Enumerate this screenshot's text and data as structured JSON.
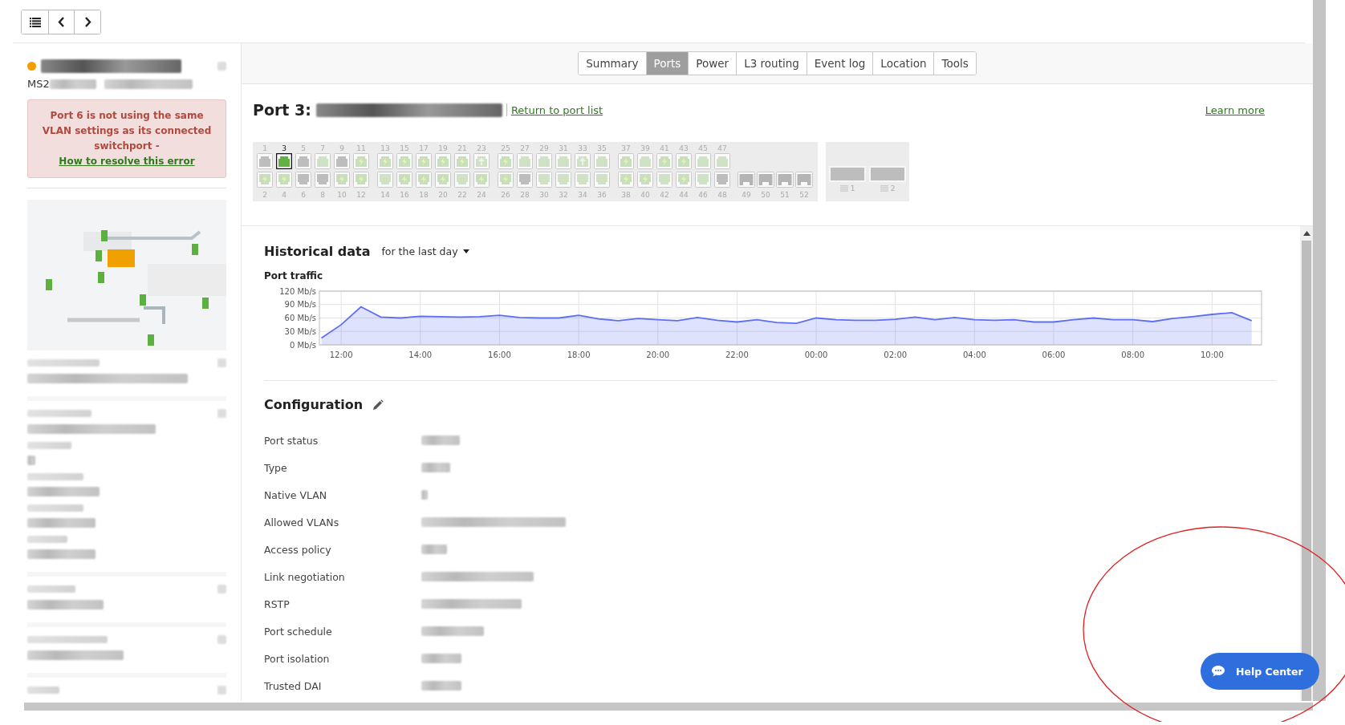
{
  "toolbar": {
    "buttons": [
      {
        "kind": "list"
      },
      {
        "kind": "prev"
      },
      {
        "kind": "next"
      }
    ]
  },
  "sidebar": {
    "model_prefix": "MS2",
    "alert": {
      "text": "Port 6 is not using the same VLAN settings as its connected switchport - ",
      "link": "How to resolve this error"
    }
  },
  "tabs": [
    {
      "label": "Summary",
      "selected": false
    },
    {
      "label": "Ports",
      "selected": true
    },
    {
      "label": "Power",
      "selected": false
    },
    {
      "label": "L3 routing",
      "selected": false
    },
    {
      "label": "Event log",
      "selected": false
    },
    {
      "label": "Location",
      "selected": false
    },
    {
      "label": "Tools",
      "selected": false
    }
  ],
  "port_header": {
    "title": "Port 3:",
    "return_link": "Return to port list",
    "learn_more": "Learn more"
  },
  "port_groups": [
    {
      "columns": [
        {
          "top": {
            "number": "1",
            "kind": "disconnected",
            "selected": false
          },
          "bottom": {
            "number": "2",
            "kind": "poe",
            "selected": false
          }
        },
        {
          "top": {
            "number": "3",
            "kind": "connected",
            "selected": true
          },
          "bottom": {
            "number": "4",
            "kind": "poe",
            "selected": false
          }
        },
        {
          "top": {
            "number": "5",
            "kind": "disconnected",
            "selected": false
          },
          "bottom": {
            "number": "6",
            "kind": "disconnected",
            "selected": false
          }
        },
        {
          "top": {
            "number": "7",
            "kind": "connected",
            "selected": false
          },
          "bottom": {
            "number": "8",
            "kind": "disconnected",
            "selected": false
          }
        },
        {
          "top": {
            "number": "9",
            "kind": "disconnected",
            "selected": false
          },
          "bottom": {
            "number": "10",
            "kind": "poe",
            "selected": false
          }
        },
        {
          "top": {
            "number": "11",
            "kind": "poe",
            "selected": false
          },
          "bottom": {
            "number": "12",
            "kind": "poe",
            "selected": false
          }
        }
      ]
    },
    {
      "columns": [
        {
          "top": {
            "number": "13",
            "kind": "poe",
            "selected": false
          },
          "bottom": {
            "number": "14",
            "kind": "connected",
            "selected": false
          }
        },
        {
          "top": {
            "number": "15",
            "kind": "poe",
            "selected": false
          },
          "bottom": {
            "number": "16",
            "kind": "poe",
            "selected": false
          }
        },
        {
          "top": {
            "number": "17",
            "kind": "poe",
            "selected": false
          },
          "bottom": {
            "number": "18",
            "kind": "poe",
            "selected": false
          }
        },
        {
          "top": {
            "number": "19",
            "kind": "poe",
            "selected": false
          },
          "bottom": {
            "number": "20",
            "kind": "poe",
            "selected": false
          }
        },
        {
          "top": {
            "number": "21",
            "kind": "poe",
            "selected": false
          },
          "bottom": {
            "number": "22",
            "kind": "connected",
            "selected": false
          }
        },
        {
          "top": {
            "number": "23",
            "kind": "uplink",
            "selected": false
          },
          "bottom": {
            "number": "24",
            "kind": "poe",
            "selected": false
          }
        }
      ]
    },
    {
      "columns": [
        {
          "top": {
            "number": "25",
            "kind": "poe",
            "selected": false
          },
          "bottom": {
            "number": "26",
            "kind": "poe",
            "selected": false
          }
        },
        {
          "top": {
            "number": "27",
            "kind": "connected",
            "selected": false
          },
          "bottom": {
            "number": "28",
            "kind": "disconnected",
            "selected": false
          }
        },
        {
          "top": {
            "number": "29",
            "kind": "connected",
            "selected": false
          },
          "bottom": {
            "number": "30",
            "kind": "connected",
            "selected": false
          }
        },
        {
          "top": {
            "number": "31",
            "kind": "connected",
            "selected": false
          },
          "bottom": {
            "number": "32",
            "kind": "connected",
            "selected": false
          }
        },
        {
          "top": {
            "number": "33",
            "kind": "uplink",
            "selected": false
          },
          "bottom": {
            "number": "34",
            "kind": "connected",
            "selected": false
          }
        },
        {
          "top": {
            "number": "35",
            "kind": "connected",
            "selected": false
          },
          "bottom": {
            "number": "36",
            "kind": "connected",
            "selected": false
          }
        }
      ]
    },
    {
      "columns": [
        {
          "top": {
            "number": "37",
            "kind": "poe",
            "selected": false
          },
          "bottom": {
            "number": "38",
            "kind": "poe",
            "selected": false
          }
        },
        {
          "top": {
            "number": "39",
            "kind": "connected",
            "selected": false
          },
          "bottom": {
            "number": "40",
            "kind": "poe",
            "selected": false
          }
        },
        {
          "top": {
            "number": "41",
            "kind": "poe",
            "selected": false
          },
          "bottom": {
            "number": "42",
            "kind": "connected",
            "selected": false
          }
        },
        {
          "top": {
            "number": "43",
            "kind": "poe",
            "selected": false
          },
          "bottom": {
            "number": "44",
            "kind": "poe",
            "selected": false
          }
        },
        {
          "top": {
            "number": "45",
            "kind": "connected",
            "selected": false
          },
          "bottom": {
            "number": "46",
            "kind": "connected",
            "selected": false
          }
        },
        {
          "top": {
            "number": "47",
            "kind": "connected",
            "selected": false
          },
          "bottom": {
            "number": "48",
            "kind": "disconnected",
            "selected": false
          }
        }
      ]
    },
    {
      "columns": [
        {
          "bottom": {
            "number": "49",
            "kind": "sfp",
            "selected": false
          }
        },
        {
          "bottom": {
            "number": "50",
            "kind": "sfp",
            "selected": false
          }
        },
        {
          "bottom": {
            "number": "51",
            "kind": "sfp",
            "selected": false
          }
        },
        {
          "bottom": {
            "number": "52",
            "kind": "sfp",
            "selected": false
          }
        }
      ]
    }
  ],
  "modules": [
    {
      "number": "1"
    },
    {
      "number": "2"
    }
  ],
  "historical": {
    "title": "Historical data",
    "range": "for the last day",
    "chart_title": "Port traffic",
    "chart_data": {
      "type": "area",
      "categories": [
        null,
        "12:00",
        null,
        null,
        null,
        "14:00",
        null,
        null,
        null,
        "16:00",
        null,
        null,
        null,
        "18:00",
        null,
        null,
        null,
        "20:00",
        null,
        null,
        null,
        "22:00",
        null,
        null,
        null,
        "00:00",
        null,
        null,
        null,
        "02:00",
        null,
        null,
        null,
        "04:00",
        null,
        null,
        null,
        "06:00",
        null,
        null,
        null,
        "08:00",
        null,
        null,
        null,
        "10:00",
        null,
        null
      ],
      "series": [
        {
          "color": "#5b6ef5",
          "values": [
            15,
            45,
            85,
            62,
            60,
            64,
            63,
            62,
            63,
            66,
            61,
            60,
            60,
            66,
            58,
            54,
            59,
            56,
            54,
            61,
            55,
            51,
            56,
            50,
            48,
            60,
            56,
            55,
            55,
            57,
            62,
            56,
            61,
            56,
            55,
            56,
            51,
            51,
            56,
            60,
            56,
            56,
            52,
            59,
            63,
            68,
            72,
            54
          ]
        }
      ],
      "ylim": [
        0,
        120
      ],
      "grid": true,
      "yticks": [
        {
          "value": 0,
          "label": "0 Mb/s"
        },
        {
          "value": 30,
          "label": "30 Mb/s"
        },
        {
          "value": 60,
          "label": "60 Mb/s"
        },
        {
          "value": 90,
          "label": "90 Mb/s"
        },
        {
          "value": 120,
          "label": "120 Mb/s"
        }
      ]
    }
  },
  "configuration": {
    "title": "Configuration",
    "rows": [
      {
        "label": "Port status"
      },
      {
        "label": "Type"
      },
      {
        "label": "Native VLAN"
      },
      {
        "label": "Allowed VLANs"
      },
      {
        "label": "Access policy"
      },
      {
        "label": "Link negotiation"
      },
      {
        "label": "RSTP"
      },
      {
        "label": "Port schedule"
      },
      {
        "label": "Port isolation"
      },
      {
        "label": "Trusted DAI"
      }
    ]
  },
  "help_button": {
    "label": "Help Center"
  }
}
